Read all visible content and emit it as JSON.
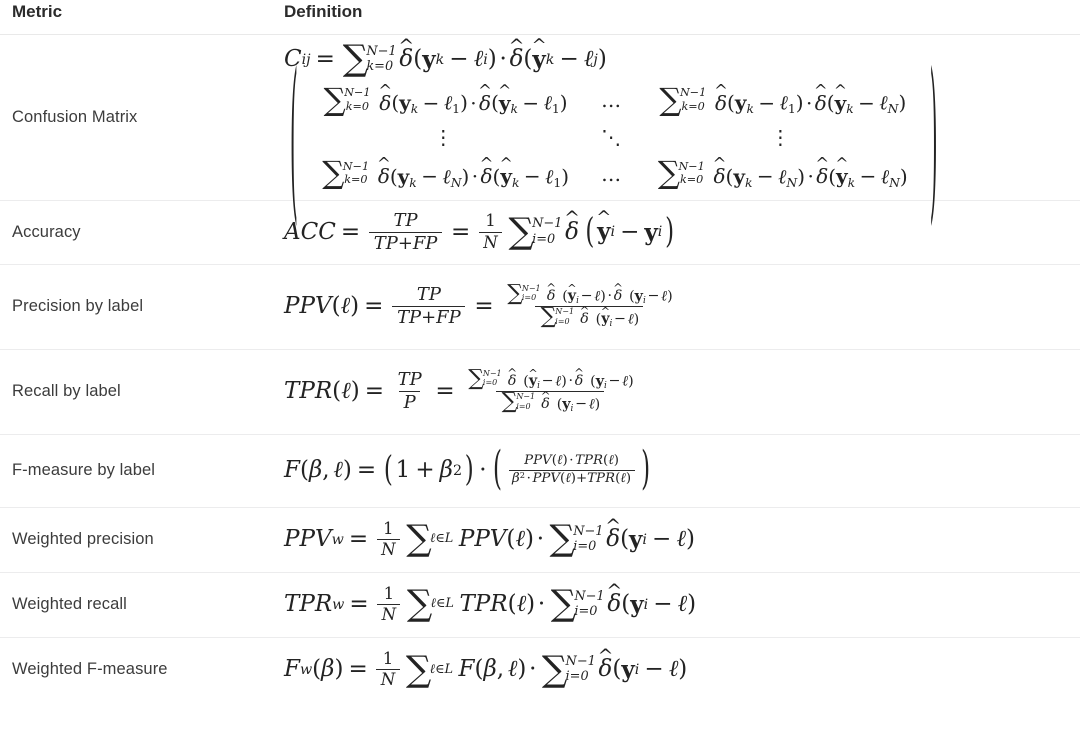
{
  "table": {
    "headers": {
      "metric": "Metric",
      "definition": "Definition"
    },
    "rows": [
      {
        "metric": "Confusion Matrix",
        "definition_text": "C_ij = sum_{k=0}^{N-1} dhat(y_k - l_i) . dhat(yhat_k - l_j)",
        "matrix": {
          "cells": [
            [
              "sum_{k=0}^{N-1} dhat(y_k - l_1) . dhat(yhat_k - l_1)",
              "…",
              "sum_{k=0}^{N-1} dhat(y_k - l_1) . dhat(yhat_k - l_N)"
            ],
            [
              "⋮",
              "⋱",
              "⋮"
            ],
            [
              "sum_{k=0}^{N-1} dhat(y_k - l_N) . dhat(yhat_k - l_1)",
              "…",
              "sum_{k=0}^{N-1} dhat(y_k - l_N) . dhat(yhat_k - l_N)"
            ]
          ],
          "ellipsis_h": "…",
          "ellipsis_v": "⋮",
          "ellipsis_d": "⋱"
        }
      },
      {
        "metric": "Accuracy",
        "definition_text": "ACC = TP/(TP+FP) = (1/N) sum_{i=0}^{N-1} dhat(yhat_i - y_i)"
      },
      {
        "metric": "Precision by label",
        "definition_text": "PPV(l) = TP/(TP+FP) = [sum_{i=0}^{N-1} dhat(yhat_i - l).dhat(y_i - l)] / [sum_{i=0}^{N-1} dhat(yhat_i - l)]"
      },
      {
        "metric": "Recall by label",
        "definition_text": "TPR(l) = TP/P = [sum_{i=0}^{N-1} dhat(yhat_i - l).dhat(y_i - l)] / [sum_{i=0}^{N-1} dhat(y_i - l)]"
      },
      {
        "metric": "F-measure by label",
        "definition_text": "F(beta, l) = (1 + beta^2) . ( PPV(l).TPR(l) / (beta^2.PPV(l) + TPR(l)) )"
      },
      {
        "metric": "Weighted precision",
        "definition_text": "PPV_w = (1/N) sum_{l in L} PPV(l) . sum_{i=0}^{N-1} dhat(y_i - l)"
      },
      {
        "metric": "Weighted recall",
        "definition_text": "TPR_w = (1/N) sum_{l in L} TPR(l) . sum_{i=0}^{N-1} dhat(y_i - l)"
      },
      {
        "metric": "Weighted F-measure",
        "definition_text": "F_w(beta) = (1/N) sum_{l in L} F(beta, l) . sum_{i=0}^{N-1} dhat(y_i - l)"
      }
    ],
    "symbols": {
      "sigma": "∑",
      "delta": "δ",
      "hat": "^",
      "ell": "ℓ",
      "beta": "β",
      "cdot": "·",
      "minus": "−",
      "equals": "=",
      "plus": "+",
      "in": "∈",
      "N": "N",
      "L": "L",
      "k": "k",
      "i": "i",
      "j": "j",
      "one": "1",
      "zero": "0",
      "two": "2",
      "N_minus_1": "N−1",
      "k_eq_0": "k=0",
      "i_eq_0": "i=0",
      "y": "y",
      "C": "C",
      "ACC": "ACC",
      "TP": "TP",
      "FP": "FP",
      "P": "P",
      "PPV": "PPV",
      "TPR": "TPR",
      "F": "F",
      "w": "w"
    },
    "colors": {
      "header_text": "#2b2b2b",
      "metric_text": "#3c3c3c",
      "math_text": "#232323",
      "divider": "#ececed",
      "background": "#ffffff"
    }
  }
}
